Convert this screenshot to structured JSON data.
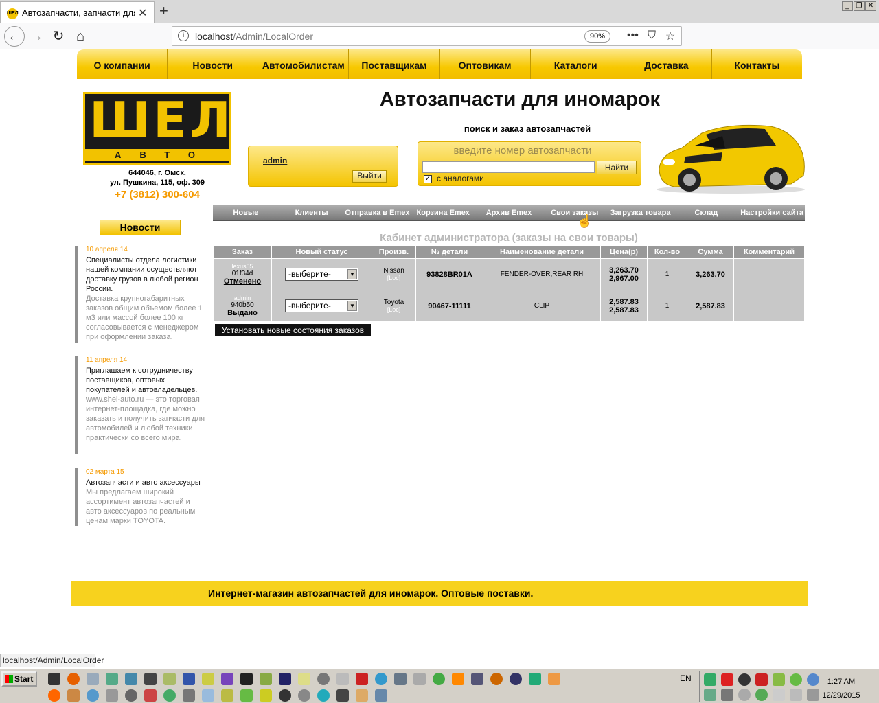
{
  "browser": {
    "tab_title": "Автозапчасти, запчасти для ино",
    "favicon_text": "ШЕЛ",
    "url_host": "localhost",
    "url_path": "/Admin/LocalOrder",
    "zoom": "90%",
    "status_text": "localhost/Admin/LocalOrder"
  },
  "site": {
    "top_menu": [
      "О компании",
      "Новости",
      "Автомобилистам",
      "Поставщикам",
      "Оптовикам",
      "Каталоги",
      "Доставка",
      "Контакты"
    ],
    "logo_big": "ШЕЛ",
    "logo_small": "АВТО",
    "address_line1": "644046, г. Омск,",
    "address_line2": "ул. Пушкина, 115, оф. 309",
    "phone": "+7 (3812) 300-604",
    "heading": "Автозапчасти для иномарок",
    "subheading": "поиск и заказ автозапчастей",
    "login": {
      "user": "admin",
      "logout": "Выйти"
    },
    "search": {
      "placeholder": "введите номер автозапчасти",
      "button": "Найти",
      "analogs": "с аналогами",
      "analogs_checked": true
    },
    "news_header": "Новости",
    "news": [
      {
        "date": "10 апреля 14",
        "title": "Специалисты отдела логистики нашей компании осуществляют доставку грузов в любой регион России.",
        "text": "Доставка крупногабаритных заказов общим объемом более 1 м3 или массой более 100 кг согласовывается с менеджером при оформлении заказа."
      },
      {
        "date": "11 апреля 14",
        "title": "Приглашаем к сотрудничеству поставщиков, оптовых покупателей и автовладельцев.",
        "text": "www.shel-auto.ru — это торговая интернет-площадка, где можно заказать и получить запчасти для автомобилей и любой техники практически со всего мира."
      },
      {
        "date": "02 марта 15",
        "title": "Автозапчасти и авто аксессуары",
        "text": "Мы предлагаем широкий ассортимент автозапчастей и авто аксессуаров по реальным ценам марки TOYOTA."
      }
    ],
    "admin_menu": [
      "Новые",
      "Клиенты",
      "Отправка в Emex",
      "Корзина Emex",
      "Архив Emex",
      "Свои заказы",
      "Загрузка товара",
      "Склад",
      "Настройки сайта"
    ],
    "cabinet_title": "Кабинет администратора (заказы на свои товары)",
    "table": {
      "headers": [
        "Заказ",
        "Новый статус",
        "Произв.",
        "№ детали",
        "Наименование детали",
        "Цена(р)",
        "Кол-во",
        "Сумма",
        "Комментарий"
      ],
      "rows": [
        {
          "user": "lexus55",
          "order": "01f34d",
          "status": "Отменено",
          "select": "-выберите-",
          "maker": "Nissan",
          "loc": "[Loc]",
          "part_no": "93828BR01A",
          "name": "FENDER-OVER,REAR RH",
          "price1": "3,263.70",
          "price2": "2,967.00",
          "qty": "1",
          "sum": "3,263.70",
          "comment": ""
        },
        {
          "user": "admin",
          "order": "940b50",
          "status": "Выдано",
          "select": "-выберите-",
          "maker": "Toyota",
          "loc": "[Loc]",
          "part_no": "90467-11111",
          "name": "CLIP",
          "price1": "2,587.83",
          "price2": "2,587.83",
          "qty": "1",
          "sum": "2,587.83",
          "comment": ""
        }
      ]
    },
    "set_status_button": "Установать новые состояния заказов",
    "footer": "Интернет-магазин автозапчастей для иномарок. Оптовые поставки."
  },
  "taskbar": {
    "start": "Start",
    "lang": "EN",
    "time": "1:27 AM",
    "date": "12/29/2015"
  },
  "colors": {
    "accent": "#f2c200",
    "menu_gray": "#999999",
    "phone": "#f59a00"
  }
}
